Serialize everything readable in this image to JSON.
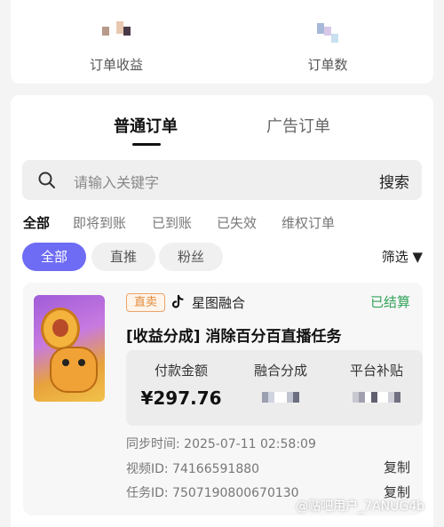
{
  "stats": {
    "order_income_label": "订单收益",
    "order_count_label": "订单数"
  },
  "tabs": [
    {
      "label": "普通订单",
      "active": true
    },
    {
      "label": "广告订单",
      "active": false
    }
  ],
  "search": {
    "placeholder": "请输入关键字",
    "button_label": "搜索"
  },
  "status_filters": [
    {
      "label": "全部",
      "active": true
    },
    {
      "label": "即将到账",
      "active": false
    },
    {
      "label": "已到账",
      "active": false
    },
    {
      "label": "已失效",
      "active": false
    },
    {
      "label": "维权订单",
      "active": false
    }
  ],
  "type_chips": [
    {
      "label": "全部",
      "active": true
    },
    {
      "label": "直推",
      "active": false
    },
    {
      "label": "粉丝",
      "active": false
    }
  ],
  "filter_dropdown": "筛选 ▼",
  "order": {
    "tag": "直卖",
    "source": "星图融合",
    "status": "已结算",
    "title": "[收益分成] 消除百分百直播任务",
    "payment_label": "付款金额",
    "payment_value": "¥297.76",
    "share_label": "融合分成",
    "subsidy_label": "平台补贴",
    "sync_time": "同步时间: 2025-07-11 02:58:09",
    "video_id": "视频ID: 74166591880",
    "task_id": "任务ID: 7507190800670130",
    "copy_label": "复制"
  },
  "watermark": "@贴吧用户_7ANUG4b",
  "colors": {
    "accent": "#6e6cf4",
    "settled_green": "#33a35a",
    "tag_orange": "#e08a3c"
  }
}
